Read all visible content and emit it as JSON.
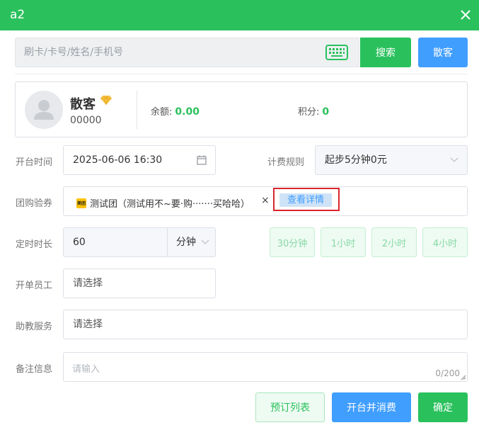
{
  "window": {
    "title": "a2"
  },
  "search": {
    "placeholder": "刷卡/卡号/姓名/手机号",
    "search_label": "搜索",
    "walkin_label": "散客"
  },
  "member": {
    "name": "散客",
    "card_no": "00000",
    "balance_label": "余额:",
    "balance": "0.00",
    "points_label": "积分:",
    "points": "0"
  },
  "form": {
    "open_time_label": "开台时间",
    "open_time": "2025-06-06 16:30",
    "billing_rule_label": "计费规则",
    "billing_rule": "起步5分钟0元",
    "group_coupon_label": "团购验券",
    "coupon_logo": "美团",
    "coupon_text": "测试团（测试用不~要·购·······买哈哈）",
    "coupon_remove": "×",
    "view_detail": "查看详情",
    "timer_label": "定时时长",
    "timer_value": "60",
    "timer_unit": "分钟",
    "quick_times": [
      "30分钟",
      "1小时",
      "2小时",
      "4小时"
    ],
    "staff_label": "开单员工",
    "staff_placeholder": "请选择",
    "assist_label": "助教服务",
    "assist_placeholder": "请选择",
    "remark_label": "备注信息",
    "remark_placeholder": "请输入",
    "remark_counter": "0/200"
  },
  "footer": {
    "reserve_list": "预订列表",
    "open_and_consume": "开台并消费",
    "confirm": "确定"
  },
  "colors": {
    "primary_green": "#2ac15d",
    "primary_blue": "#409eff",
    "highlight_red": "#d9262d"
  }
}
